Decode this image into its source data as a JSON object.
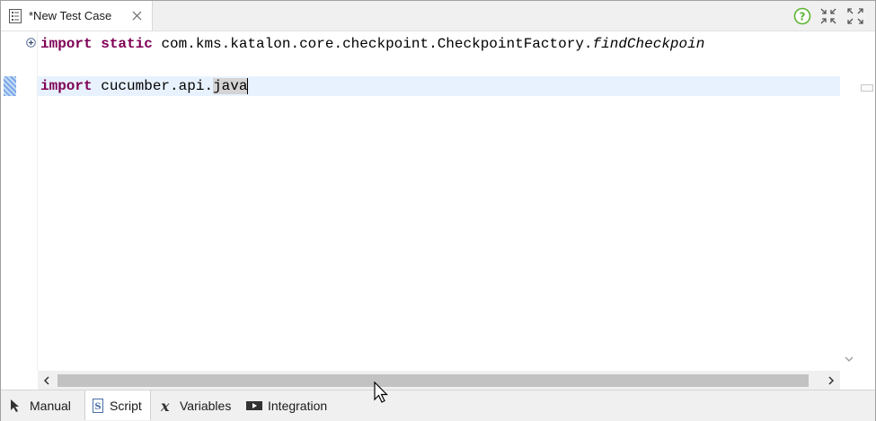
{
  "editor_tab": {
    "title": "*New Test Case",
    "icon": "test-case-icon",
    "close_icon": "close-icon"
  },
  "toolbar": {
    "help_icon": "help-icon",
    "minimize_icon": "minimize-icon",
    "maximize_icon": "maximize-icon",
    "help_color": "#5cb531"
  },
  "code": {
    "line1": {
      "keyword1": "import",
      "keyword2": "static",
      "text": "com.kms.katalon.core.checkpoint.CheckpointFactory.",
      "italic": "findCheckpoin"
    },
    "line2": {
      "keyword": "import",
      "text": "cucumber.api.",
      "selected": "java"
    },
    "keyword_color": "#7f0055"
  },
  "bottom_tabs": [
    {
      "label": "Manual",
      "icon": "manual-cursor-icon"
    },
    {
      "label": "Script",
      "icon": "script-icon",
      "active": true
    },
    {
      "label": "Variables",
      "icon": "variables-icon"
    },
    {
      "label": "Integration",
      "icon": "integration-icon"
    }
  ]
}
